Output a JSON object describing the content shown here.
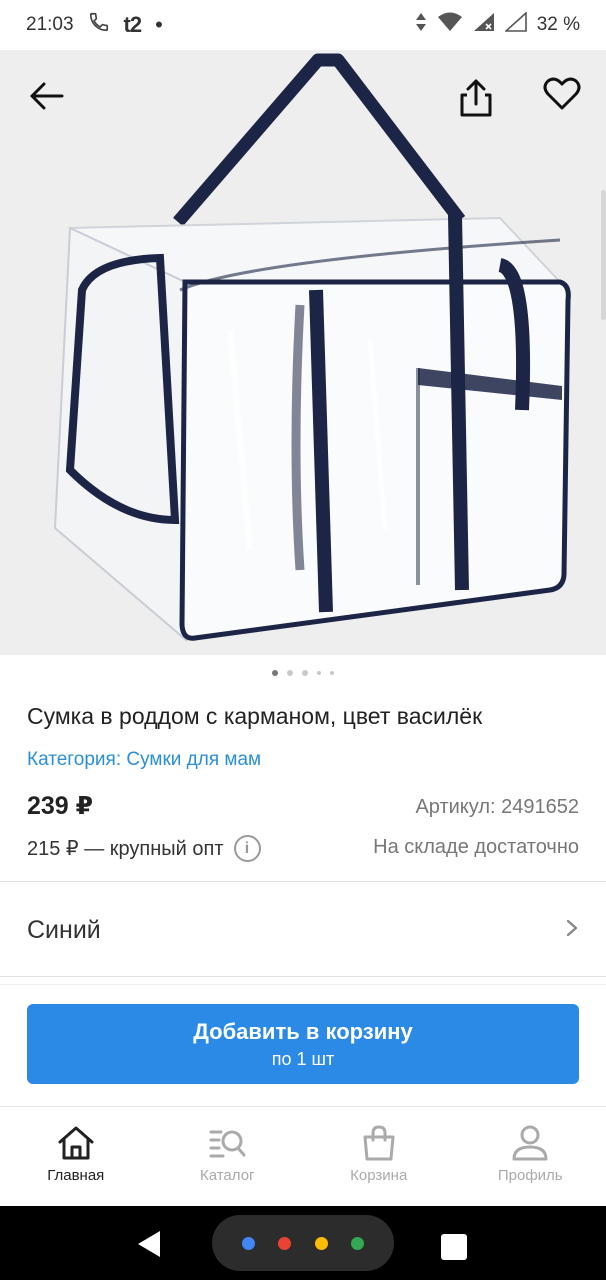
{
  "status_bar": {
    "time": "21:03",
    "carrier": "t2",
    "dot": "•",
    "battery": "32 %"
  },
  "hero": {
    "back_icon": "arrow-left-icon",
    "share_icon": "share-icon",
    "favorite_icon": "heart-icon",
    "pages": 5,
    "active_page": 1
  },
  "product": {
    "title": "Сумка в роддом с карманом, цвет василёк",
    "category": "Категория: Сумки для мам",
    "price": "239 ₽",
    "sku": "Артикул: 2491652",
    "wholesale": "215 ₽ — крупный опт",
    "stock": "На складе достаточно"
  },
  "variant": {
    "label": "Синий"
  },
  "cart_button": {
    "line1": "Добавить в корзину",
    "line2": "по 1 шт"
  },
  "bottom_nav": {
    "items": [
      {
        "label": "Главная",
        "icon": "home-icon",
        "active": true
      },
      {
        "label": "Каталог",
        "icon": "catalog-search-icon",
        "active": false
      },
      {
        "label": "Корзина",
        "icon": "shopping-bag-icon",
        "active": false
      },
      {
        "label": "Профиль",
        "icon": "profile-icon",
        "active": false
      }
    ]
  },
  "colors": {
    "accent": "#2a8ae6",
    "link": "#2b8fd6",
    "bag_trim": "#1c2545"
  }
}
